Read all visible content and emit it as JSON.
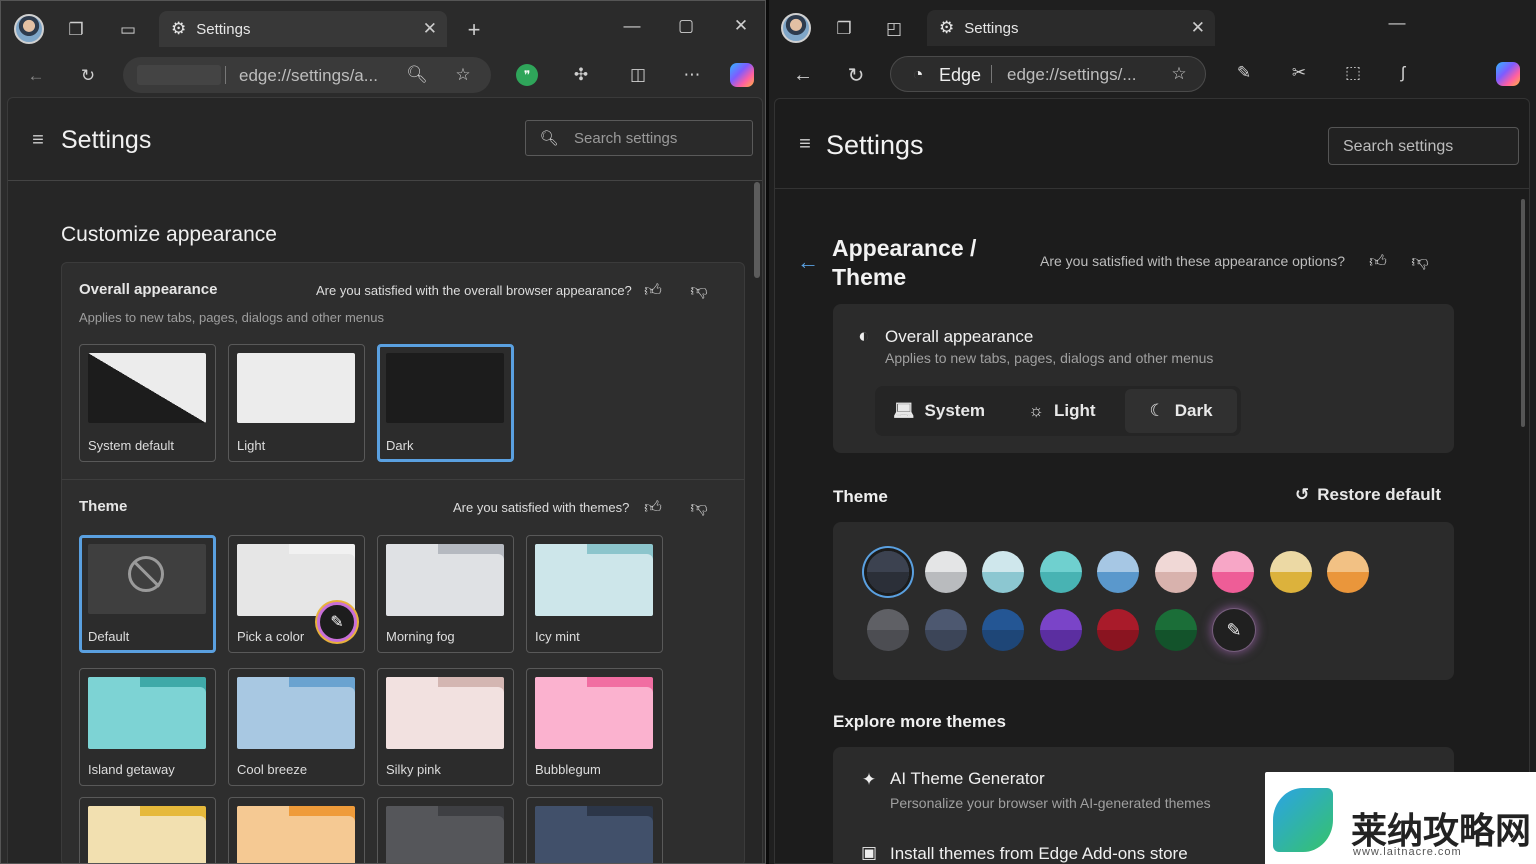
{
  "left": {
    "tab_title": "Settings",
    "address_text": "edge://settings/a...",
    "page_title": "Settings",
    "search_placeholder": "Search settings",
    "section_title": "Customize appearance",
    "overall": {
      "title": "Overall appearance",
      "feedback": "Are you satisfied with the overall browser appearance?",
      "subtitle": "Applies to new tabs, pages, dialogs and other menus",
      "options": [
        "System default",
        "Light",
        "Dark"
      ],
      "selected": "Dark"
    },
    "theme": {
      "title": "Theme",
      "feedback": "Are you satisfied with themes?",
      "items": [
        {
          "label": "Default",
          "colors": [
            "#3f3f3f",
            "#3f3f3f"
          ]
        },
        {
          "label": "Pick a color",
          "colors": [
            "#f1f1f1",
            "#e6e6e6"
          ]
        },
        {
          "label": "Morning fog",
          "colors": [
            "#b5b9c0",
            "#dfe1e4"
          ]
        },
        {
          "label": "Icy mint",
          "colors": [
            "#8cc5cc",
            "#cde6ea"
          ]
        },
        {
          "label": "Island getaway",
          "colors": [
            "#3fa9a8",
            "#7dd3d4"
          ]
        },
        {
          "label": "Cool breeze",
          "colors": [
            "#6aa3d0",
            "#a8c8e2"
          ]
        },
        {
          "label": "Silky pink",
          "colors": [
            "#d4b6b2",
            "#f2e1e0"
          ]
        },
        {
          "label": "Bubblegum",
          "colors": [
            "#f16ea2",
            "#fbb2cf"
          ]
        },
        {
          "label": "",
          "colors": [
            "#e6b93b",
            "#f2e0b0"
          ]
        },
        {
          "label": "",
          "colors": [
            "#ef9b3a",
            "#f5c993"
          ]
        },
        {
          "label": "",
          "colors": [
            "#3e3f43",
            "#55565a"
          ]
        },
        {
          "label": "",
          "colors": [
            "#2c3648",
            "#41506a"
          ]
        }
      ]
    }
  },
  "right": {
    "tab_title": "Settings",
    "site_label": "Edge",
    "address_text": "edge://settings/...",
    "page_title": "Settings",
    "search_placeholder": "Search settings",
    "breadcrumb_line1": "Appearance /",
    "breadcrumb_line2": "Theme",
    "feedback": "Are you satisfied with these appearance options?",
    "overall": {
      "title": "Overall appearance",
      "subtitle": "Applies to new tabs, pages, dialogs and other menus",
      "options": [
        "System",
        "Light",
        "Dark"
      ],
      "selected": "Dark"
    },
    "theme": {
      "title": "Theme",
      "restore": "Restore default",
      "colors": [
        [
          "#2b2f38",
          "#3c4250"
        ],
        [
          "#b9bbbe",
          "#e4e5e6"
        ],
        [
          "#8cc7d1",
          "#cfe7ec"
        ],
        [
          "#48b3b3",
          "#6fd0cf"
        ],
        [
          "#5a98cc",
          "#a6c7e4"
        ],
        [
          "#d8b2ad",
          "#f0d8d6"
        ],
        [
          "#ee5d97",
          "#f7a6c6"
        ],
        [
          "#dcb23c",
          "#ecd9a4"
        ],
        [
          "#ea963b",
          "#f2c184"
        ],
        [
          "#4c4d52",
          "#5f6065"
        ],
        [
          "#3c4558",
          "#4d5870"
        ],
        [
          "#1e4677",
          "#245694"
        ],
        [
          "#5b2ea0",
          "#7a44c8"
        ],
        [
          "#8a1420",
          "#a91b2a"
        ],
        [
          "#13532b",
          "#1b6e38"
        ]
      ]
    },
    "explore": {
      "title": "Explore more themes",
      "items": [
        {
          "title": "AI Theme Generator",
          "subtitle": "Personalize your browser with AI-generated themes"
        },
        {
          "title": "Install themes from Edge Add-ons store",
          "subtitle": ""
        }
      ]
    }
  },
  "watermark": {
    "text": "莱纳攻略网",
    "url": "www.laitnacre.com"
  }
}
